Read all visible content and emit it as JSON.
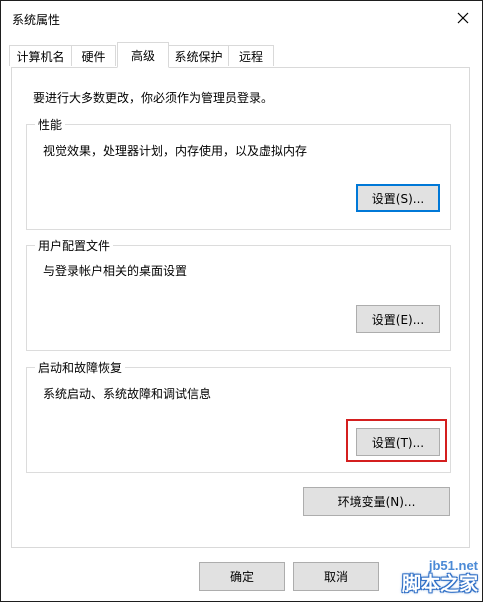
{
  "window": {
    "title": "系统属性"
  },
  "tabs": [
    {
      "label": "计算机名"
    },
    {
      "label": "硬件"
    },
    {
      "label": "高级",
      "active": true
    },
    {
      "label": "系统保护"
    },
    {
      "label": "远程"
    }
  ],
  "main": {
    "intro": "要进行大多数更改，你必须作为管理员登录。",
    "performance": {
      "title": "性能",
      "description": "视觉效果，处理器计划，内存使用，以及虚拟内存",
      "button": "设置(S)..."
    },
    "user_profiles": {
      "title": "用户配置文件",
      "description": "与登录帐户相关的桌面设置",
      "button": "设置(E)..."
    },
    "startup_recovery": {
      "title": "启动和故障恢复",
      "description": "系统启动、系统故障和调试信息",
      "button": "设置(T)..."
    },
    "env_button": "环境变量(N)..."
  },
  "footer": {
    "ok": "确定",
    "cancel": "取消"
  },
  "watermark": {
    "url": "jb51.net",
    "brand": "脚本之家"
  },
  "colors": {
    "default_button_border": "#0078d7",
    "highlight_box": "#d41f1f",
    "watermark": "#2f6fc6"
  },
  "icons": {
    "close": "close-icon"
  }
}
